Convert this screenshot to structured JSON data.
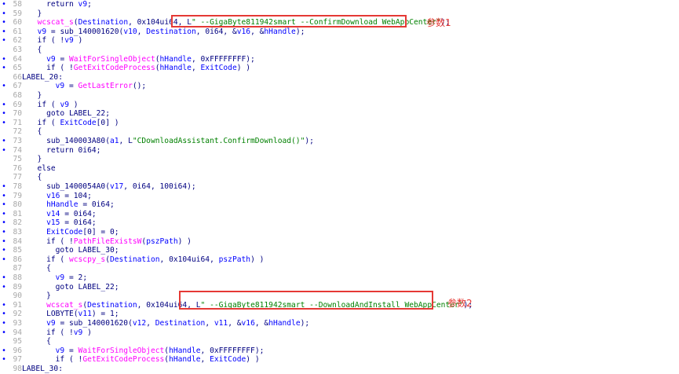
{
  "colors": {
    "background": "#ffffff",
    "line_number": "#a8a8a8",
    "plain": "#000080",
    "function": "#ff00ff",
    "variable": "#0000ff",
    "string": "#008000",
    "highlight_box": "#e53935"
  },
  "annotations": {
    "param1": "参数1",
    "param2": "参数2"
  },
  "lines": [
    {
      "no": "58",
      "bullet": true,
      "tokens": [
        [
          "plain",
          "    return "
        ],
        [
          "var",
          "v9"
        ],
        [
          "plain",
          ";"
        ]
      ]
    },
    {
      "no": "59",
      "bullet": true,
      "tokens": [
        [
          "plain",
          "  }"
        ]
      ]
    },
    {
      "no": "60",
      "bullet": true,
      "tokens": [
        [
          "plain",
          "  "
        ],
        [
          "func",
          "wcscat_s"
        ],
        [
          "plain",
          "("
        ],
        [
          "var",
          "Destination"
        ],
        [
          "plain",
          ", 0x104ui64, L"
        ],
        [
          "str",
          "\" --GigaByte811942smart --ConfirmDownload WebAppCenter\""
        ],
        [
          "plain",
          ");"
        ]
      ]
    },
    {
      "no": "61",
      "bullet": true,
      "tokens": [
        [
          "plain",
          "  "
        ],
        [
          "var",
          "v9"
        ],
        [
          "plain",
          " = sub_140001620("
        ],
        [
          "var",
          "v10"
        ],
        [
          "plain",
          ", "
        ],
        [
          "var",
          "Destination"
        ],
        [
          "plain",
          ", 0i64, &"
        ],
        [
          "var",
          "v16"
        ],
        [
          "plain",
          ", &"
        ],
        [
          "var",
          "hHandle"
        ],
        [
          "plain",
          ");"
        ]
      ]
    },
    {
      "no": "62",
      "bullet": true,
      "tokens": [
        [
          "plain",
          "  if ( !"
        ],
        [
          "var",
          "v9"
        ],
        [
          "plain",
          " )"
        ]
      ]
    },
    {
      "no": "63",
      "bullet": false,
      "tokens": [
        [
          "plain",
          "  {"
        ]
      ]
    },
    {
      "no": "64",
      "bullet": true,
      "tokens": [
        [
          "plain",
          "    "
        ],
        [
          "var",
          "v9"
        ],
        [
          "plain",
          " = "
        ],
        [
          "func",
          "WaitForSingleObject"
        ],
        [
          "plain",
          "("
        ],
        [
          "var",
          "hHandle"
        ],
        [
          "plain",
          ", 0xFFFFFFFF);"
        ]
      ]
    },
    {
      "no": "65",
      "bullet": true,
      "tokens": [
        [
          "plain",
          "    if ( !"
        ],
        [
          "func",
          "GetExitCodeProcess"
        ],
        [
          "plain",
          "("
        ],
        [
          "var",
          "hHandle"
        ],
        [
          "plain",
          ", "
        ],
        [
          "var",
          "ExitCode"
        ],
        [
          "plain",
          ") )"
        ]
      ]
    },
    {
      "no": "66",
      "bullet": false,
      "tokens": [
        [
          "label",
          "LABEL_20:"
        ]
      ],
      "flush": true
    },
    {
      "no": "67",
      "bullet": true,
      "tokens": [
        [
          "plain",
          "      "
        ],
        [
          "var",
          "v9"
        ],
        [
          "plain",
          " = "
        ],
        [
          "func",
          "GetLastError"
        ],
        [
          "plain",
          "();"
        ]
      ]
    },
    {
      "no": "68",
      "bullet": false,
      "tokens": [
        [
          "plain",
          "  }"
        ]
      ]
    },
    {
      "no": "69",
      "bullet": true,
      "tokens": [
        [
          "plain",
          "  if ( "
        ],
        [
          "var",
          "v9"
        ],
        [
          "plain",
          " )"
        ]
      ]
    },
    {
      "no": "70",
      "bullet": true,
      "tokens": [
        [
          "plain",
          "    goto LABEL_22;"
        ]
      ]
    },
    {
      "no": "71",
      "bullet": true,
      "tokens": [
        [
          "plain",
          "  if ( "
        ],
        [
          "var",
          "ExitCode"
        ],
        [
          "plain",
          "[0] )"
        ]
      ]
    },
    {
      "no": "72",
      "bullet": false,
      "tokens": [
        [
          "plain",
          "  {"
        ]
      ]
    },
    {
      "no": "73",
      "bullet": true,
      "tokens": [
        [
          "plain",
          "    sub_140003A80("
        ],
        [
          "var",
          "a1"
        ],
        [
          "plain",
          ", L"
        ],
        [
          "str",
          "\"CDownloadAssistant.ConfirmDownload()\""
        ],
        [
          "plain",
          ");"
        ]
      ]
    },
    {
      "no": "74",
      "bullet": true,
      "tokens": [
        [
          "plain",
          "    return 0i64;"
        ]
      ]
    },
    {
      "no": "75",
      "bullet": false,
      "tokens": [
        [
          "plain",
          "  }"
        ]
      ]
    },
    {
      "no": "76",
      "bullet": false,
      "tokens": [
        [
          "plain",
          "  else"
        ]
      ]
    },
    {
      "no": "77",
      "bullet": false,
      "tokens": [
        [
          "plain",
          "  {"
        ]
      ]
    },
    {
      "no": "78",
      "bullet": true,
      "tokens": [
        [
          "plain",
          "    sub_1400054A0("
        ],
        [
          "var",
          "v17"
        ],
        [
          "plain",
          ", 0i64, 100i64);"
        ]
      ]
    },
    {
      "no": "79",
      "bullet": true,
      "tokens": [
        [
          "plain",
          "    "
        ],
        [
          "var",
          "v16"
        ],
        [
          "plain",
          " = 104;"
        ]
      ]
    },
    {
      "no": "80",
      "bullet": true,
      "tokens": [
        [
          "plain",
          "    "
        ],
        [
          "var",
          "hHandle"
        ],
        [
          "plain",
          " = 0i64;"
        ]
      ]
    },
    {
      "no": "81",
      "bullet": true,
      "tokens": [
        [
          "plain",
          "    "
        ],
        [
          "var",
          "v14"
        ],
        [
          "plain",
          " = 0i64;"
        ]
      ]
    },
    {
      "no": "82",
      "bullet": true,
      "tokens": [
        [
          "plain",
          "    "
        ],
        [
          "var",
          "v15"
        ],
        [
          "plain",
          " = 0i64;"
        ]
      ]
    },
    {
      "no": "83",
      "bullet": true,
      "tokens": [
        [
          "plain",
          "    "
        ],
        [
          "var",
          "ExitCode"
        ],
        [
          "plain",
          "[0] = 0;"
        ]
      ]
    },
    {
      "no": "84",
      "bullet": true,
      "tokens": [
        [
          "plain",
          "    if ( !"
        ],
        [
          "func",
          "PathFileExistsW"
        ],
        [
          "plain",
          "("
        ],
        [
          "var",
          "pszPath"
        ],
        [
          "plain",
          ") )"
        ]
      ]
    },
    {
      "no": "85",
      "bullet": true,
      "tokens": [
        [
          "plain",
          "      goto LABEL_30;"
        ]
      ]
    },
    {
      "no": "86",
      "bullet": true,
      "tokens": [
        [
          "plain",
          "    if ( "
        ],
        [
          "func",
          "wcscpy_s"
        ],
        [
          "plain",
          "("
        ],
        [
          "var",
          "Destination"
        ],
        [
          "plain",
          ", 0x104ui64, "
        ],
        [
          "var",
          "pszPath"
        ],
        [
          "plain",
          ") )"
        ]
      ]
    },
    {
      "no": "87",
      "bullet": false,
      "tokens": [
        [
          "plain",
          "    {"
        ]
      ]
    },
    {
      "no": "88",
      "bullet": true,
      "tokens": [
        [
          "plain",
          "      "
        ],
        [
          "var",
          "v9"
        ],
        [
          "plain",
          " = 2;"
        ]
      ]
    },
    {
      "no": "89",
      "bullet": true,
      "tokens": [
        [
          "plain",
          "      goto LABEL_22;"
        ]
      ]
    },
    {
      "no": "90",
      "bullet": false,
      "tokens": [
        [
          "plain",
          "    }"
        ]
      ]
    },
    {
      "no": "91",
      "bullet": true,
      "tokens": [
        [
          "plain",
          "    "
        ],
        [
          "func",
          "wcscat_s"
        ],
        [
          "plain",
          "("
        ],
        [
          "var",
          "Destination"
        ],
        [
          "plain",
          ", 0x104ui64, L"
        ],
        [
          "str",
          "\" --GigaByte811942smart --DownloadAndInstall WebAppCenter\""
        ],
        [
          "plain",
          ");"
        ]
      ]
    },
    {
      "no": "92",
      "bullet": true,
      "tokens": [
        [
          "plain",
          "    LOBYTE("
        ],
        [
          "var",
          "v11"
        ],
        [
          "plain",
          ") = 1;"
        ]
      ]
    },
    {
      "no": "93",
      "bullet": true,
      "tokens": [
        [
          "plain",
          "    "
        ],
        [
          "var",
          "v9"
        ],
        [
          "plain",
          " = sub_140001620("
        ],
        [
          "var",
          "v12"
        ],
        [
          "plain",
          ", "
        ],
        [
          "var",
          "Destination"
        ],
        [
          "plain",
          ", "
        ],
        [
          "var",
          "v11"
        ],
        [
          "plain",
          ", &"
        ],
        [
          "var",
          "v16"
        ],
        [
          "plain",
          ", &"
        ],
        [
          "var",
          "hHandle"
        ],
        [
          "plain",
          ");"
        ]
      ]
    },
    {
      "no": "94",
      "bullet": true,
      "tokens": [
        [
          "plain",
          "    if ( !"
        ],
        [
          "var",
          "v9"
        ],
        [
          "plain",
          " )"
        ]
      ]
    },
    {
      "no": "95",
      "bullet": false,
      "tokens": [
        [
          "plain",
          "    {"
        ]
      ]
    },
    {
      "no": "96",
      "bullet": true,
      "tokens": [
        [
          "plain",
          "      "
        ],
        [
          "var",
          "v9"
        ],
        [
          "plain",
          " = "
        ],
        [
          "func",
          "WaitForSingleObject"
        ],
        [
          "plain",
          "("
        ],
        [
          "var",
          "hHandle"
        ],
        [
          "plain",
          ", 0xFFFFFFFF);"
        ]
      ]
    },
    {
      "no": "97",
      "bullet": true,
      "tokens": [
        [
          "plain",
          "      if ( !"
        ],
        [
          "func",
          "GetExitCodeProcess"
        ],
        [
          "plain",
          "("
        ],
        [
          "var",
          "hHandle"
        ],
        [
          "plain",
          ", "
        ],
        [
          "var",
          "ExitCode"
        ],
        [
          "plain",
          ") )"
        ]
      ]
    },
    {
      "no": "98",
      "bullet": false,
      "tokens": [
        [
          "label",
          "LABEL_30:"
        ]
      ],
      "flush": true
    }
  ]
}
